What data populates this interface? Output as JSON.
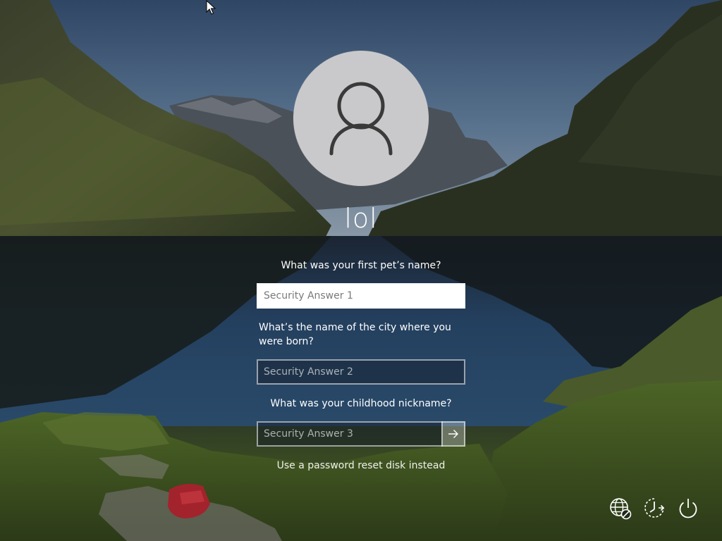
{
  "user": {
    "name": "lol",
    "avatar_icon": "user-silhouette-icon"
  },
  "security_questions": [
    {
      "question": "What was your first pet’s name?",
      "placeholder": "Security Answer 1",
      "value": "",
      "focused": true
    },
    {
      "question": "What’s the name of the city where you were born?",
      "placeholder": "Security Answer 2",
      "value": "",
      "focused": false
    },
    {
      "question": "What was your childhood nickname?",
      "placeholder": "Security Answer 3",
      "value": "",
      "focused": false
    }
  ],
  "submit_icon": "arrow-right-icon",
  "reset_disk_link": "Use a password reset disk instead",
  "corner_buttons": [
    {
      "name": "network",
      "icon": "network-globe-icon"
    },
    {
      "name": "ease-of-access",
      "icon": "ease-of-access-icon"
    },
    {
      "name": "power",
      "icon": "power-icon"
    }
  ],
  "colors": {
    "text": "#ffffff",
    "avatar_bg": "#c9c9cb",
    "avatar_figure": "#3a3a3a",
    "field_border": "#b8bcc2",
    "active_field_bg": "#ffffff"
  }
}
